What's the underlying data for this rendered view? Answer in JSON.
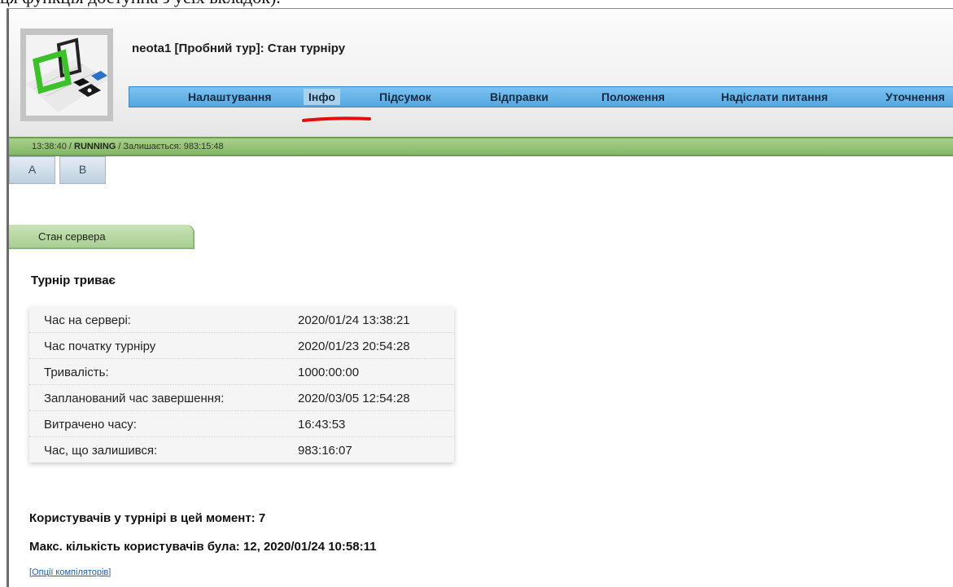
{
  "top_caption": "ця функція доступна з усіх вкладок).",
  "app": {
    "title": "neota1 [Пробний тур]: Стан турніру"
  },
  "menu": {
    "items": [
      {
        "label": "Налаштування",
        "active": false
      },
      {
        "label": "Інфо",
        "active": true
      },
      {
        "label": "Підсумок",
        "active": false
      },
      {
        "label": "Відправки",
        "active": false
      },
      {
        "label": "Положення",
        "active": false
      },
      {
        "label": "Надіслати питання",
        "active": false
      },
      {
        "label": "Уточнення",
        "active": false
      }
    ]
  },
  "status": {
    "time": "13:38:40",
    "sep1": " / ",
    "state": "RUNNING",
    "sep2": " / ",
    "remaining": "Залишається: 983:15:48"
  },
  "problem_tabs": [
    "A",
    "B"
  ],
  "section": {
    "title": "Стан сервера"
  },
  "main": {
    "heading": "Турнір триває",
    "table": [
      {
        "label": "Час на сервері:",
        "value": "2020/01/24 13:38:21"
      },
      {
        "label": "Час початку турніру",
        "value": "2020/01/23 20:54:28"
      },
      {
        "label": "Тривалість:",
        "value": "1000:00:00"
      },
      {
        "label": "Запланований час завершення:",
        "value": "2020/03/05 12:54:28"
      },
      {
        "label": "Витрачено часу:",
        "value": "16:43:53"
      },
      {
        "label": "Час, що залишився:",
        "value": "983:16:07"
      }
    ],
    "users_now": "Користувачів у турнірі в цей момент: 7",
    "users_max": "Макс. кількість користувачів була: 12, 2020/01/24 10:58:11",
    "compilers_link": "Опції компіляторів"
  },
  "colors": {
    "menu_bar": "#62b0e6",
    "status_bar": "#95c27a",
    "annotation_underline": "#e01010"
  }
}
